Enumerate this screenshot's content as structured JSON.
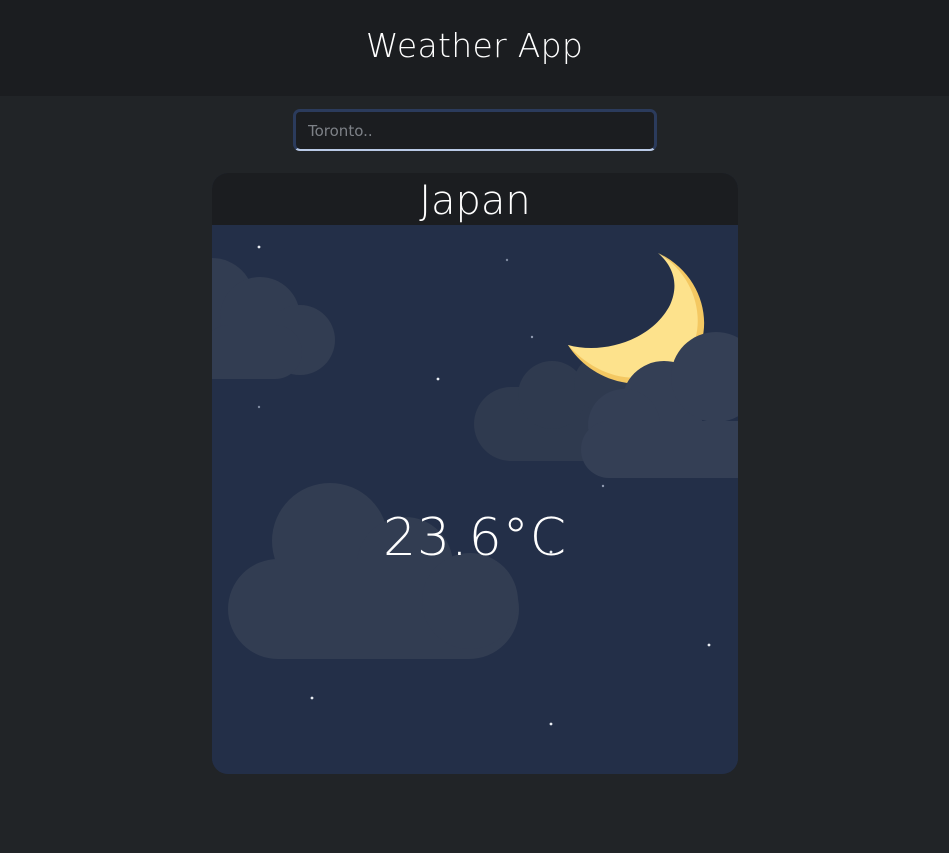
{
  "header": {
    "title": "Weather App"
  },
  "search": {
    "placeholder": "Toronto..",
    "value": ""
  },
  "weather_card": {
    "location": "Japan",
    "temperature": "23.6°C",
    "condition_icons": [
      "night-sky",
      "moon-icon",
      "cloud-icon"
    ]
  },
  "colors": {
    "page_background": "#212427",
    "header_background": "#1b1d20",
    "night_sky": "#232f48",
    "cloud": "#323d52",
    "moon": "#fde28c",
    "moon_shade": "#f4c862"
  }
}
